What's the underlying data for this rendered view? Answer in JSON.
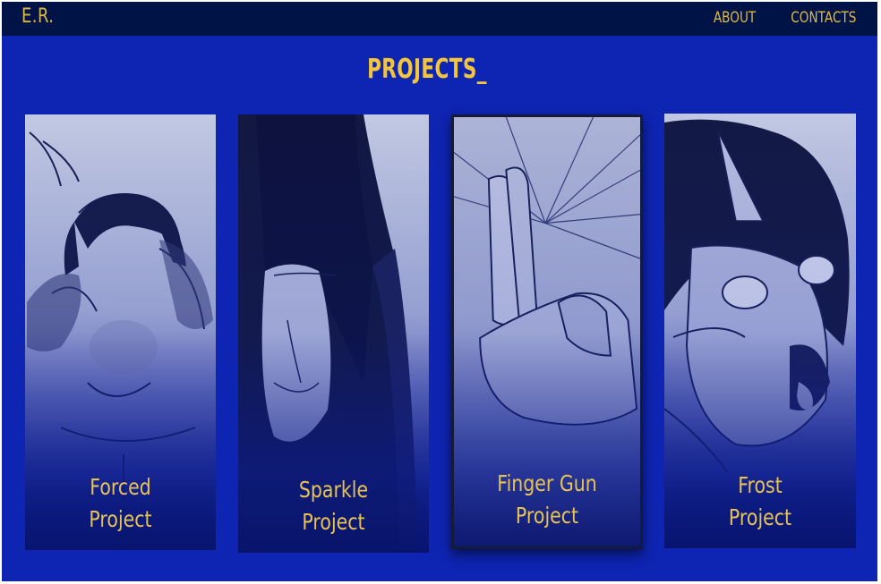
{
  "site": {
    "logo": "E.R."
  },
  "nav": {
    "items": [
      {
        "label": "ABOUT"
      },
      {
        "label": "CONTACTS"
      }
    ]
  },
  "page": {
    "title": "PROJECTS_"
  },
  "projects": [
    {
      "line1": "Forced",
      "line2": "Project",
      "art": "sketch of person clutching head"
    },
    {
      "line1": "Sparkle",
      "line2": "Project",
      "art": "sketch of crying face with long hair"
    },
    {
      "line1": "Finger Gun",
      "line2": "Project",
      "art": "sketch of hand making finger gun"
    },
    {
      "line1": "Frost",
      "line2": "Project",
      "art": "sketch of screaming face with horn"
    }
  ],
  "colors": {
    "background": "#0e24b2",
    "topbar": "#001346",
    "accent": "#ddb845",
    "title": "#f2c53a"
  }
}
